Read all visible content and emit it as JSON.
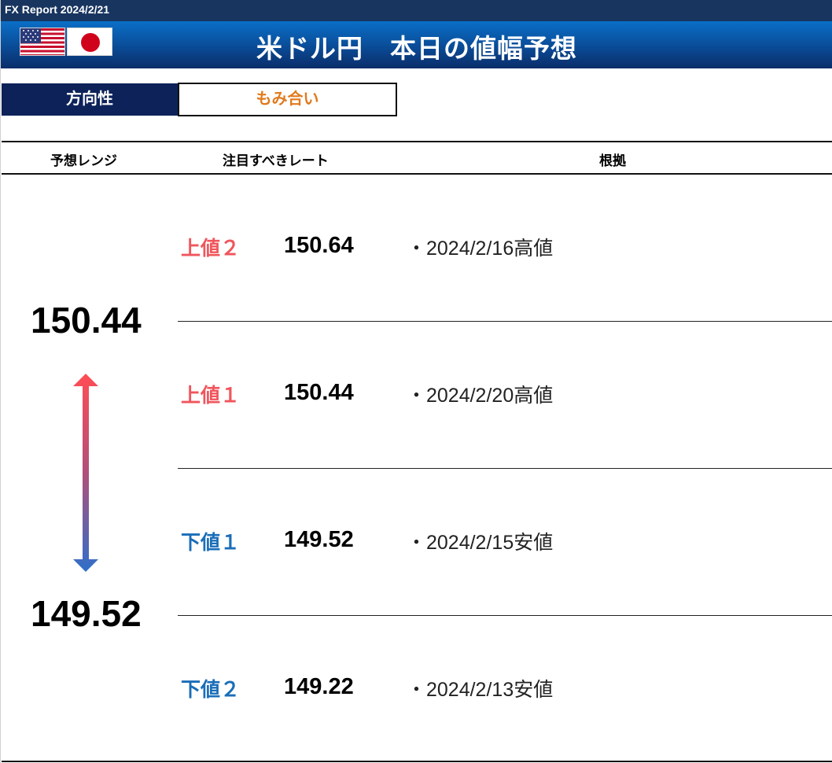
{
  "header": {
    "report_label": "FX Report 2024/2/21",
    "title": "米ドル円　本日の値幅予想"
  },
  "flags": [
    "us-flag-icon",
    "japan-flag-icon"
  ],
  "direction": {
    "label": "方向性",
    "value": "もみ合い"
  },
  "columns": {
    "range": "予想レンジ",
    "rate": "注目すべきレート",
    "basis": "根拠"
  },
  "range": {
    "high": "150.44",
    "low": "149.52"
  },
  "levels": [
    {
      "label": "上値２",
      "value": "150.64",
      "basis": "・2024/2/16高値"
    },
    {
      "label": "上値１",
      "value": "150.44",
      "basis": "・2024/2/20高値"
    },
    {
      "label": "下値１",
      "value": "149.52",
      "basis": "・2024/2/15安値"
    },
    {
      "label": "下値２",
      "value": "149.22",
      "basis": "・2024/2/13安値"
    }
  ],
  "colors": {
    "header_dark": "#17355f",
    "title_gradient_top": "#0a6fc7",
    "title_gradient_bottom": "#0a2d69",
    "direction_label_bg": "#0c2259",
    "direction_value": "#e07a1d",
    "upper": "#f0555c",
    "lower": "#1a6db8"
  }
}
